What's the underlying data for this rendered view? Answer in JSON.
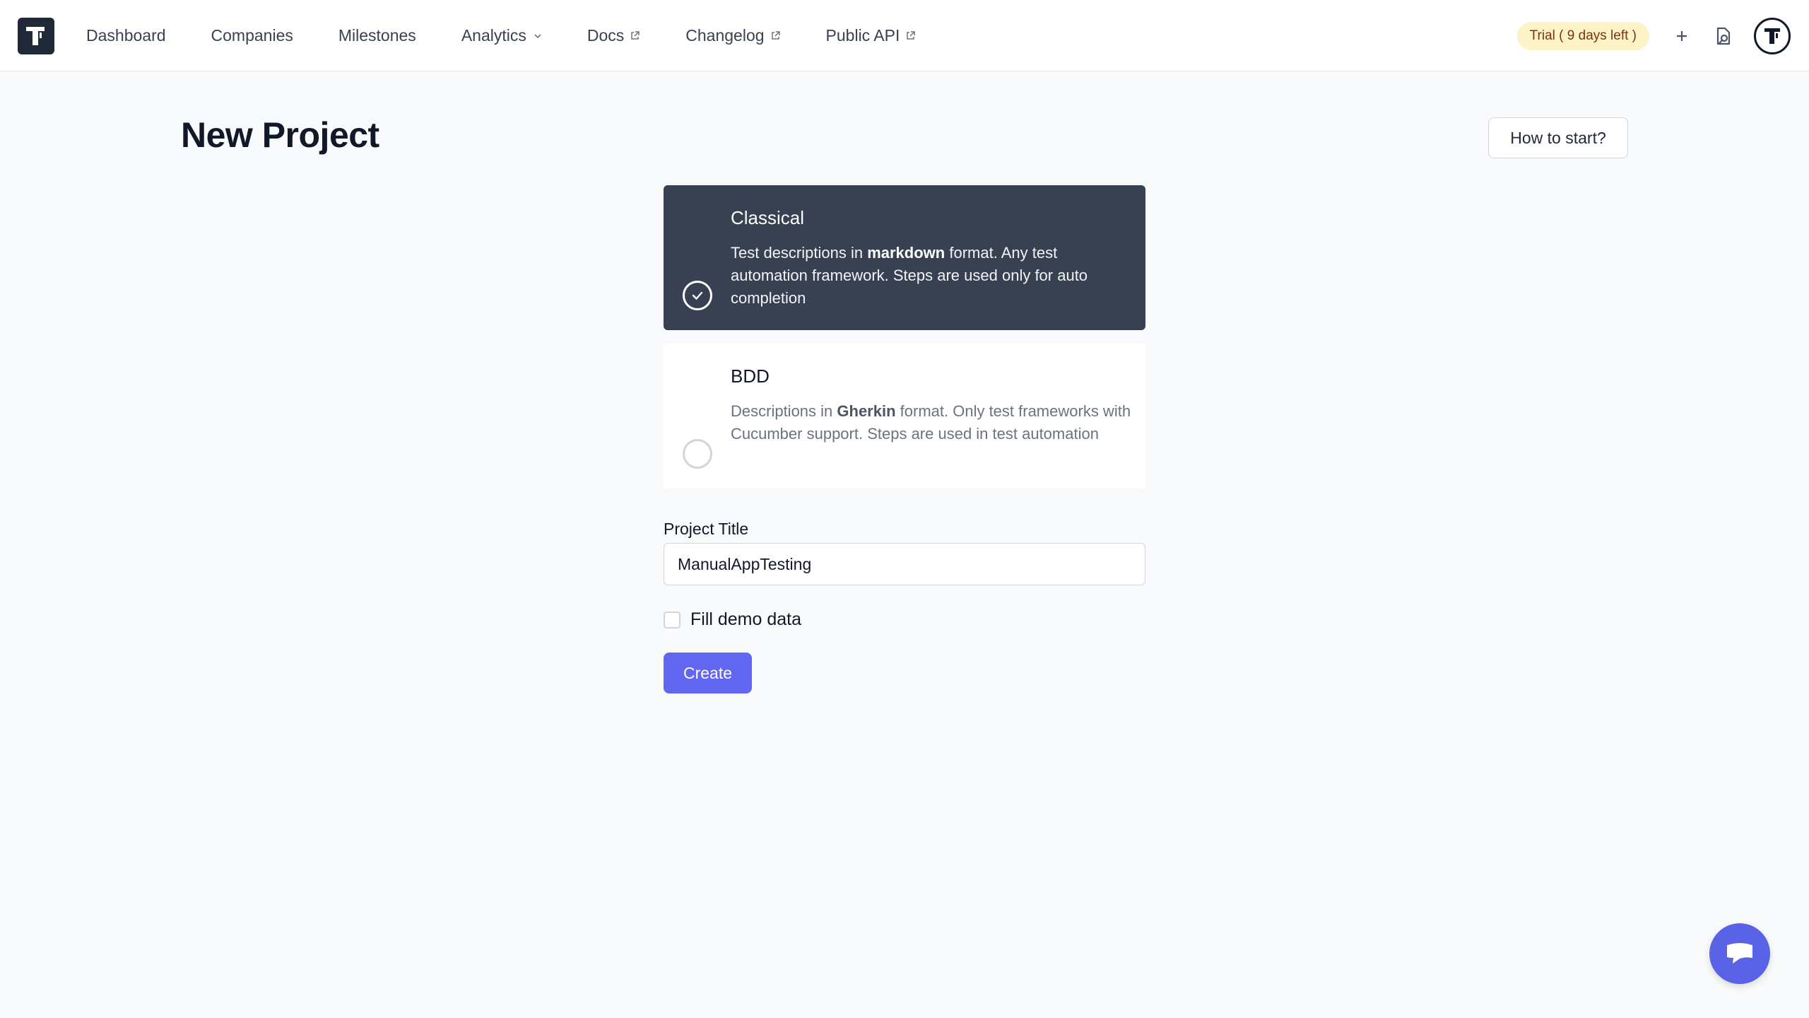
{
  "header": {
    "nav": [
      {
        "label": "Dashboard"
      },
      {
        "label": "Companies"
      },
      {
        "label": "Milestones"
      },
      {
        "label": "Analytics"
      },
      {
        "label": "Docs"
      },
      {
        "label": "Changelog"
      },
      {
        "label": "Public API"
      }
    ],
    "trial_badge": "Trial ( 9 days left )",
    "icons": {
      "logo": "testomat-logo-icon",
      "add": "plus-icon",
      "search": "document-search-icon",
      "avatar": "user-avatar-icon"
    }
  },
  "page": {
    "title": "New Project",
    "how_to_start": "How to start?"
  },
  "project_types": [
    {
      "title": "Classical",
      "selected": true,
      "desc_prefix": "Test descriptions in ",
      "desc_bold": "markdown",
      "desc_suffix": " format. Any test automation framework. Steps are used only for auto completion"
    },
    {
      "title": "BDD",
      "selected": false,
      "desc_prefix": "Descriptions in ",
      "desc_bold": "Gherkin",
      "desc_suffix": " format. Only test frameworks with Cucumber support. Steps are used in test automation"
    }
  ],
  "form": {
    "title_label": "Project Title",
    "title_value": "ManualAppTesting",
    "demo_label": "Fill demo data",
    "demo_checked": false,
    "create_label": "Create"
  },
  "colors": {
    "accent": "#6366f1",
    "selected_card": "#374151",
    "trial_bg": "#fef3c7"
  }
}
